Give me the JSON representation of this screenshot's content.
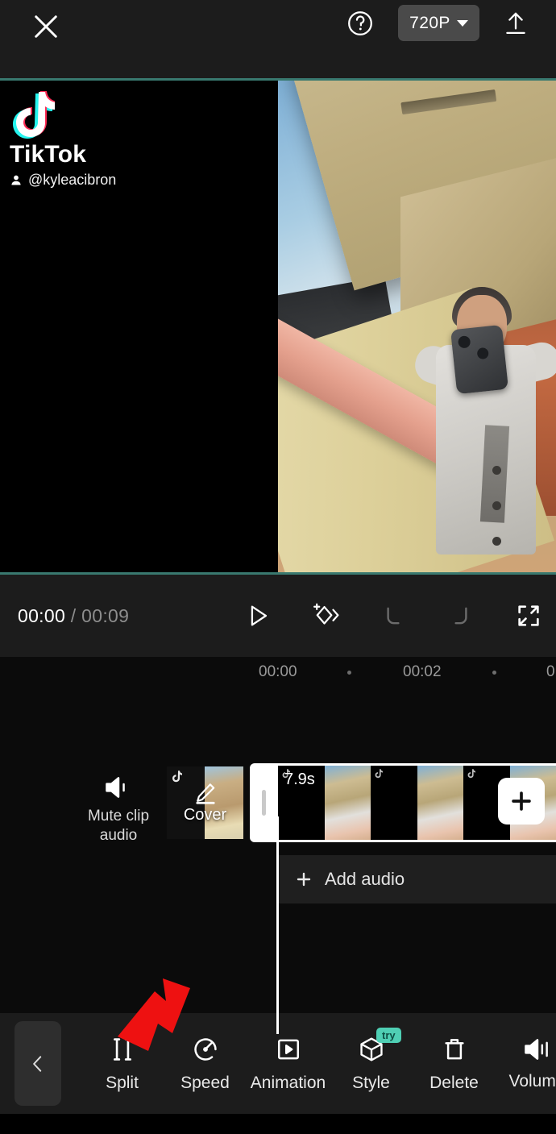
{
  "header": {
    "close_icon": "close-icon",
    "help_icon": "help-circle-icon",
    "resolution_label": "720P",
    "export_icon": "upload-icon"
  },
  "preview": {
    "watermark_title": "TikTok",
    "watermark_user": "@kyleacibron"
  },
  "playback": {
    "current_time": "00:00",
    "separator": "/",
    "total_time": "00:09",
    "play_icon": "play-icon",
    "keyframe_icon": "add-keyframe-icon",
    "undo_icon": "undo-icon",
    "redo_icon": "redo-icon",
    "fullscreen_icon": "fullscreen-icon"
  },
  "timeline": {
    "ruler_ticks": [
      "00:00",
      "00:02",
      "0"
    ],
    "mute_clip_label_line1": "Mute clip",
    "mute_clip_label_line2": "audio",
    "mute_icon": "speaker-mute-icon",
    "cover_label": "Cover",
    "cover_icon": "pencil-icon",
    "clip_duration": "7.9s",
    "add_clip_icon": "plus-icon",
    "add_audio_label": "Add audio",
    "add_audio_icon": "plus-icon"
  },
  "toolbar": {
    "back_icon": "chevron-left-icon",
    "tools": [
      {
        "label": "Split",
        "icon": "split-icon",
        "badge": ""
      },
      {
        "label": "Speed",
        "icon": "speedometer-icon",
        "badge": ""
      },
      {
        "label": "Animation",
        "icon": "animation-play-icon",
        "badge": ""
      },
      {
        "label": "Style",
        "icon": "cube-icon",
        "badge": "try"
      },
      {
        "label": "Delete",
        "icon": "trash-icon",
        "badge": ""
      },
      {
        "label": "Volume",
        "icon": "speaker-volume-icon",
        "badge": ""
      }
    ]
  },
  "annotation": {
    "arrow_color": "#ee1111",
    "points_at": "Split"
  },
  "colors": {
    "background": "#0b0b0b",
    "bar": "#1c1c1c",
    "accent_teal": "#39796f",
    "badge_teal": "#4fcfb4",
    "chip_grey": "#4a4a4a"
  }
}
